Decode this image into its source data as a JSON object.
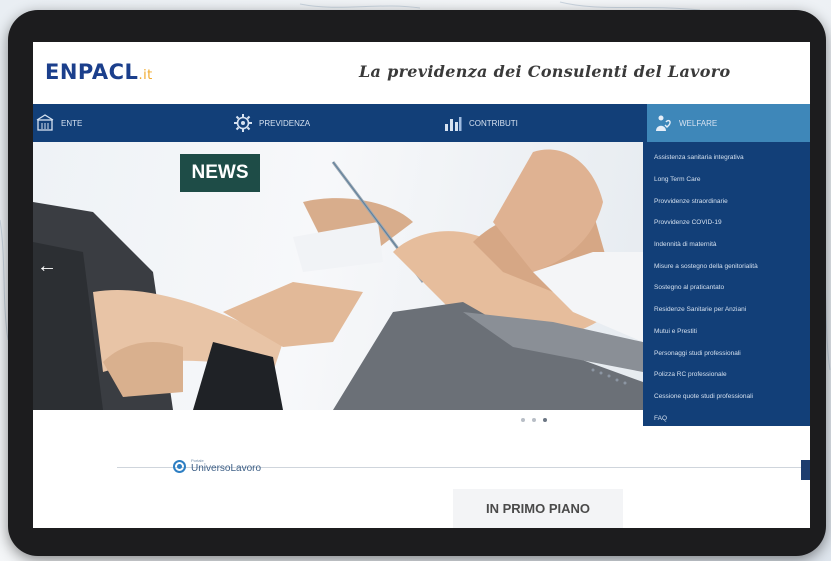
{
  "header": {
    "logo": "ENPACL",
    "logo_tld": ".it",
    "tagline": "La previdenza dei Consulenti del Lavoro"
  },
  "nav": {
    "items": [
      {
        "label": "Ente",
        "icon": "building-icon"
      },
      {
        "label": "Previdenza",
        "icon": "gear-icon"
      },
      {
        "label": "Contributi",
        "icon": "chart-icon"
      },
      {
        "label": "Welfare",
        "icon": "welfare-icon"
      }
    ]
  },
  "hero": {
    "badge": "NEWS",
    "prev_arrow": "←",
    "slides_total": 3,
    "slide_active": 3
  },
  "dropdown": {
    "items": [
      "Assistenza sanitaria integrativa",
      "Long Term Care",
      "Provvidenze straordinarie",
      "Provvidenze COVID-19",
      "Indennità di maternità",
      "Misure a sostegno della genitorialità",
      "Sostegno al praticantato",
      "Residenze Sanitarie per Anziani",
      "Mutui e Prestiti",
      "Personaggi studi professionali",
      "Polizza RC professionale",
      "Cessione quote studi professionali",
      "FAQ"
    ]
  },
  "lower": {
    "universo_small": "Portale",
    "universo": "UniversoLavoro",
    "in_primo_piano": "IN PRIMO PIANO"
  },
  "colors": {
    "nav_bg": "#123f78",
    "nav_active": "#3e87b9",
    "news_badge": "#1e4c47",
    "logo": "#1b3f8c",
    "logo_tld": "#f0a92b"
  }
}
